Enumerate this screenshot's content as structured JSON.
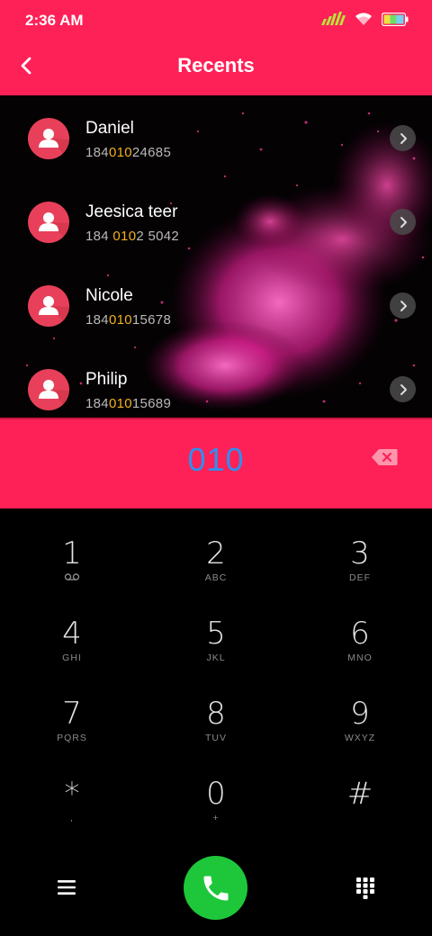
{
  "status": {
    "time": "2:36 AM",
    "icons": [
      "signal-icon",
      "wifi-icon",
      "battery-icon"
    ]
  },
  "header": {
    "title": "Recents",
    "back_icon": "chevron-left-icon"
  },
  "contacts": [
    {
      "name": "Daniel",
      "number_pre": "184",
      "number_match": "010",
      "number_post": "24685"
    },
    {
      "name": "Jeesica teer",
      "number_pre": "184 ",
      "number_match": "010",
      "number_post": "2 5042"
    },
    {
      "name": "Nicole",
      "number_pre": "184",
      "number_match": "010",
      "number_post": "15678"
    },
    {
      "name": "Philip",
      "number_pre": "184",
      "number_match": "010",
      "number_post": "15689"
    }
  ],
  "dialer": {
    "value": "010",
    "delete_icon": "backspace-icon"
  },
  "keypad": [
    {
      "digit": "1",
      "letters": ""
    },
    {
      "digit": "2",
      "letters": "ABC"
    },
    {
      "digit": "3",
      "letters": "DEF"
    },
    {
      "digit": "4",
      "letters": "GHI"
    },
    {
      "digit": "5",
      "letters": "JKL"
    },
    {
      "digit": "6",
      "letters": "MNO"
    },
    {
      "digit": "7",
      "letters": "PQRS"
    },
    {
      "digit": "8",
      "letters": "TUV"
    },
    {
      "digit": "9",
      "letters": "WXYZ"
    },
    {
      "digit": "*",
      "letters": ","
    },
    {
      "digit": "0",
      "letters": "+"
    },
    {
      "digit": "#",
      "letters": ""
    }
  ],
  "bottom": {
    "menu_icon": "menu-icon",
    "call_icon": "phone-icon",
    "grid_icon": "dialpad-icon"
  },
  "colors": {
    "accent": "#fe2157",
    "highlight": "#f2b01e",
    "dial_text": "#2f8ef0",
    "call": "#1ec73a"
  }
}
